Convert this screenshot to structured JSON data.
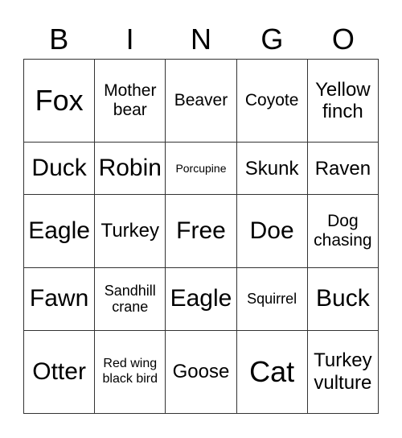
{
  "header": [
    "B",
    "I",
    "N",
    "G",
    "O"
  ],
  "grid": [
    [
      "Fox",
      "Mother bear",
      "Beaver",
      "Coyote",
      "Yellow finch"
    ],
    [
      "Duck",
      "Robin",
      "Porcupine",
      "Skunk",
      "Raven"
    ],
    [
      "Eagle",
      "Turkey",
      "Free",
      "Doe",
      "Dog chasing"
    ],
    [
      "Fawn",
      "Sandhill crane",
      "Eagle",
      "Squirrel",
      "Buck"
    ],
    [
      "Otter",
      "Red wing black bird",
      "Goose",
      "Cat",
      "Turkey vulture"
    ]
  ]
}
